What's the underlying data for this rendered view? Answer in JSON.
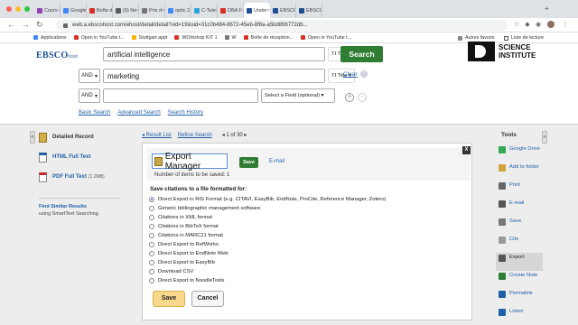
{
  "browser": {
    "tabs": [
      {
        "label": "Cours o",
        "color": "#8e44ad",
        "active": false
      },
      {
        "label": "Google",
        "color": "#4285f4",
        "active": false
      },
      {
        "label": "Boîte d",
        "color": "#d93025",
        "active": false
      },
      {
        "label": "(6) Ne",
        "color": "#5b5b5b",
        "active": false
      },
      {
        "label": "Prix d",
        "color": "#777777",
        "active": false
      },
      {
        "label": "optic 2",
        "color": "#4285f4",
        "active": false
      },
      {
        "label": "C-Tele",
        "color": "#2ba2d9",
        "active": false
      },
      {
        "label": "DBA F",
        "color": "#d93025",
        "active": false
      },
      {
        "label": "Under",
        "color": "#1d4f91",
        "active": true
      },
      {
        "label": "EBSCO",
        "color": "#1d4f91",
        "active": false
      },
      {
        "label": "EBSCO",
        "color": "#1d4f91",
        "active": false
      }
    ],
    "url": "web.a.ebscohost.com/ehost/detail/detail?vid=19&sid=31c0b484-8672-45eb-8f8a-a5bd896772db...",
    "bookmarks": [
      {
        "label": "Applications",
        "color": "#4285f4"
      },
      {
        "label": "Open in YouTube t...",
        "color": "#d93025"
      },
      {
        "label": "Stuttgart appt",
        "color": "#f4b400"
      },
      {
        "label": "WOrkshop KIT 1",
        "color": "#d93025"
      },
      {
        "label": "W",
        "color": "#777777"
      },
      {
        "label": "Boîte de réception...",
        "color": "#d93025"
      },
      {
        "label": "Open in YouTube t...",
        "color": "#d93025"
      }
    ],
    "bookmarks_right": [
      "Autres favoris",
      "Liste de lecture"
    ]
  },
  "search": {
    "logo": "EBSCO",
    "logo_suffix": "host",
    "rows": [
      {
        "bool": "",
        "value": "artificial intelligence",
        "field": "TI Title"
      },
      {
        "bool": "AND",
        "value": "marketing",
        "field": "TI Title"
      },
      {
        "bool": "AND",
        "value": "",
        "field": "Select a Field (optional)"
      }
    ],
    "search_button": "Search",
    "clear_link": "Clear",
    "help": "?",
    "links": [
      "Basic Search",
      "Advanced Search",
      "Search History"
    ],
    "institute": [
      "SCIENCE",
      "INSTITUTE"
    ]
  },
  "left_panel": {
    "detailed_record": "Detailed Record",
    "html_full_text": "HTML Full Text",
    "pdf_full_text": "PDF Full Text",
    "pdf_size": "(1.2MB)",
    "similar_title": "Find Similar Results",
    "similar_sub": "using SmartText Searching."
  },
  "nav": {
    "result_list": "◂ Result List",
    "refine_search": "Refine Search",
    "pager": "◂ 1 of 30 ▸"
  },
  "export": {
    "title": "Export Manager",
    "save_button": "Save",
    "email_link": "E-mail",
    "items_saved": "Number of items to be saved: 1",
    "save_citations_label": "Save citations to a file formatted for:",
    "options": [
      "Direct Export in RIS Format (e.g. CITAVI, EasyBib, EndNote, ProCite, Reference Manager, Zotero)",
      "Generic bibliographic management software",
      "Citations in XML format",
      "Citations in BibTeX format",
      "Citations in MARC21 format",
      "Direct Export to RefWorks",
      "Direct Export to EndNote Web",
      "Direct Export to EasyBib",
      "Download CSV",
      "Direct Export to NoodleTools"
    ],
    "selected_index": 0,
    "save_label": "Save",
    "cancel_label": "Cancel",
    "close": "X"
  },
  "tools": {
    "title": "Tools",
    "items": [
      {
        "label": "Google Drive",
        "icon": "google-drive-icon",
        "color": "#34a853"
      },
      {
        "label": "Add to folder",
        "icon": "folder-icon",
        "color": "#d4a23c"
      },
      {
        "label": "Print",
        "icon": "print-icon",
        "color": "#666666"
      },
      {
        "label": "E-mail",
        "icon": "email-icon",
        "color": "#555555"
      },
      {
        "label": "Save",
        "icon": "save-icon",
        "color": "#777777"
      },
      {
        "label": "Cite",
        "icon": "cite-icon",
        "color": "#999999"
      },
      {
        "label": "Export",
        "icon": "export-icon",
        "color": "#555555"
      },
      {
        "label": "Create Note",
        "icon": "note-icon",
        "color": "#2e7d32"
      },
      {
        "label": "Permalink",
        "icon": "link-icon",
        "color": "#1f5fa8"
      },
      {
        "label": "Listen",
        "icon": "listen-icon",
        "color": "#1f5fa8"
      }
    ],
    "selected": "Export"
  }
}
